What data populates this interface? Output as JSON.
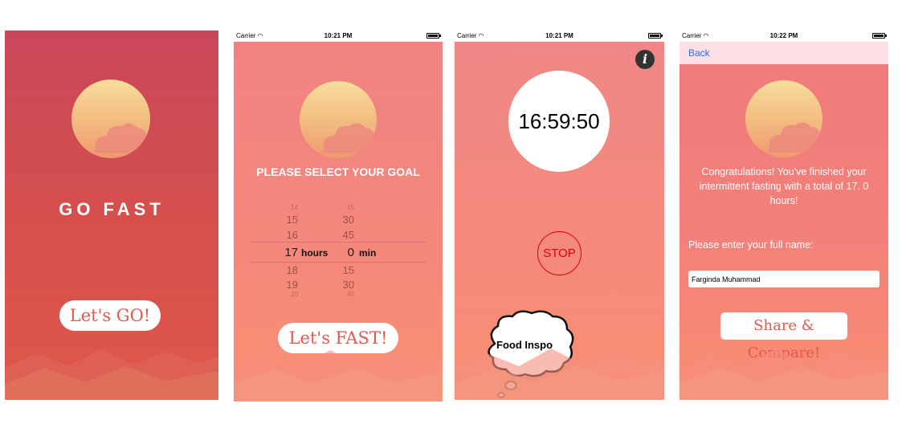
{
  "screen1": {
    "title": "GO FAST",
    "button": "Let's GO!"
  },
  "screen2": {
    "status": {
      "carrier": "Carrier",
      "time": "10:21 PM"
    },
    "heading": "PLEASE SELECT YOUR GOAL",
    "picker": {
      "hours_rows": [
        "14",
        "15",
        "16",
        "17",
        "18",
        "19",
        "20"
      ],
      "minutes_rows": [
        "15",
        "30",
        "45",
        "0",
        "15",
        "30",
        "45"
      ],
      "selected_hours": "17",
      "selected_minutes": "0",
      "hours_unit": "hours",
      "minutes_unit": "min"
    },
    "button": "Let's FAST!"
  },
  "screen3": {
    "status": {
      "carrier": "Carrier",
      "time": "10:21 PM"
    },
    "timer": "16:59:50",
    "info_glyph": "i",
    "stop": "STOP",
    "food_inspo": "Food Inspo"
  },
  "screen4": {
    "status": {
      "carrier": "Carrier",
      "time": "10:22 PM"
    },
    "back": "Back",
    "congrats": "Congratulations! You've finished your intermittent fasting with a total of 17. 0 hours!",
    "name_label": "Please enter your full name:",
    "name_value": "Farginda Muhammad",
    "button": "Share & Compare!"
  },
  "colors": {
    "screen1_bg": "#d04d50",
    "screen_bg": "#f4857d",
    "button_text": "#e2584b",
    "stop": "#e00000",
    "link": "#2f6fe0"
  },
  "icons": [
    "wifi-icon",
    "battery-icon",
    "info-icon",
    "sun-icon",
    "cloud-icon",
    "mountains-icon",
    "thought-bubble-icon"
  ]
}
